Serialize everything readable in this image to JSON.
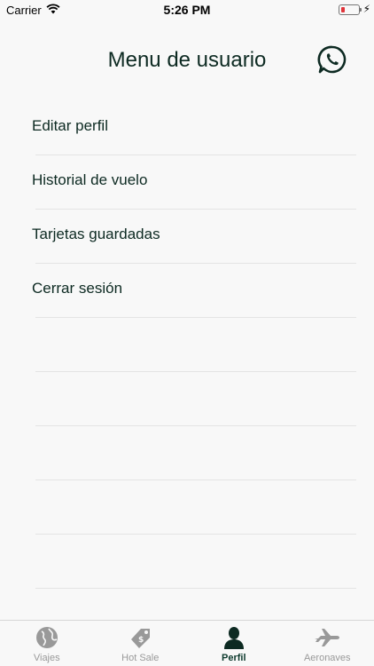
{
  "status_bar": {
    "carrier": "Carrier",
    "time": "5:26 PM"
  },
  "header": {
    "title": "Menu de usuario",
    "whatsapp_icon": "whatsapp-icon"
  },
  "menu": {
    "items": [
      {
        "label": "Editar perfil"
      },
      {
        "label": "Historial de vuelo"
      },
      {
        "label": "Tarjetas guardadas"
      },
      {
        "label": "Cerrar sesión"
      }
    ]
  },
  "tabbar": {
    "tabs": [
      {
        "label": "Viajes",
        "icon": "globe-icon"
      },
      {
        "label": "Hot Sale",
        "icon": "price-tag-icon"
      },
      {
        "label": "Perfil",
        "icon": "person-icon",
        "active": true
      },
      {
        "label": "Aeronaves",
        "icon": "airplane-icon"
      }
    ]
  },
  "colors": {
    "primary": "#0d2a22",
    "background": "#f8f8f8",
    "inactive_tab": "#999999",
    "separator": "#e4e4e4",
    "battery_low": "#e0343a"
  }
}
